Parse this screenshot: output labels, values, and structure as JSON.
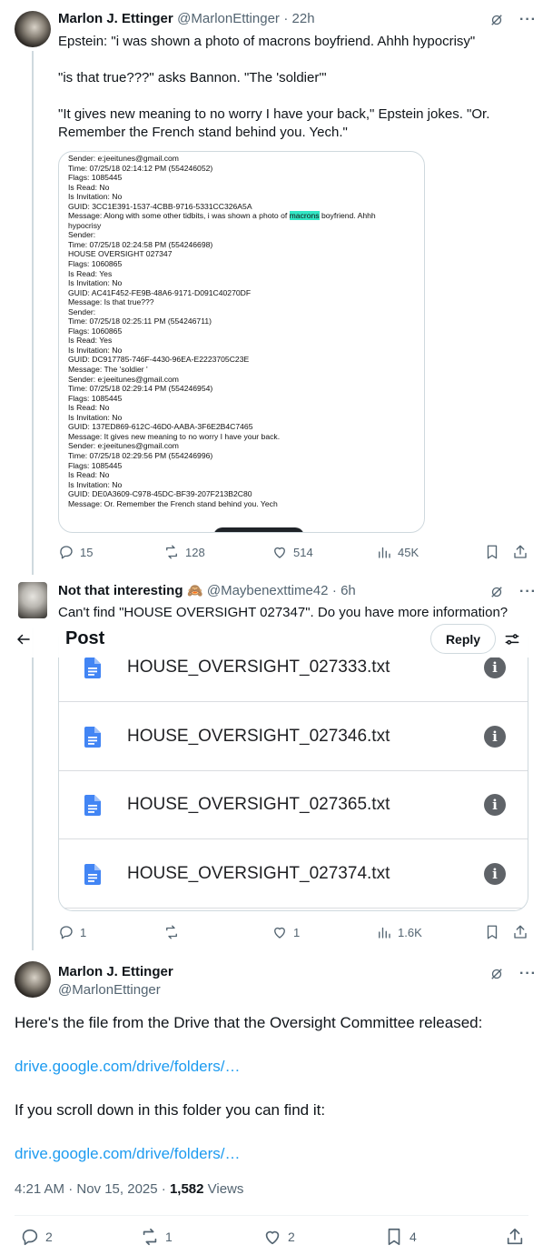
{
  "tweet1": {
    "name": "Marlon J. Ettinger",
    "handle": "@MarlonEttinger",
    "time": "· 22h",
    "text": "Epstein: \"i was shown a photo of macrons boyfriend. Ahhh hypocrisy\"\n\n\"is that true???\" asks Bannon. \"The 'soldier'\"\n\n\"It gives new meaning to no worry I have your back,\" Epstein jokes. \"Or. Remember the French stand behind you. Yech.\"",
    "log_lines": [
      "Sender: e:jeeitunes@gmail.com",
      "Time: 07/25/18 02:14:12 PM (554246052)",
      "Flags: 1085445",
      "Is Read: No",
      "Is Invitation: No",
      "GUID: 3CC1E391-1537-4CBB-9716-5331CC326A5A",
      "Message: Along with some other tidbits, i was shown a photo of |macrons| boyfriend. Ahhh",
      "hypocrisy",
      "Sender:",
      "Time: 07/25/18 02:24:58 PM (554246698)",
      "HOUSE OVERSIGHT 027347",
      "Flags: 1060865",
      "Is Read: Yes",
      "Is Invitation: No",
      "GUID: AC41F452-FE9B-48A6-9171-D091C40270DF",
      "Message: Is that true???",
      "Sender:",
      "Time: 07/25/18 02:25:11 PM (554246711)",
      "Flags: 1060865",
      "Is Read: Yes",
      "Is Invitation: No",
      "GUID: DC917785-746F-4430-96EA-E2223705C23E",
      "Message: The 'soldier '",
      "Sender: e:jeeitunes@gmail.com",
      "Time: 07/25/18 02:29:14 PM (554246954)",
      "Flags: 1085445",
      "Is Read: No",
      "Is Invitation: No",
      "GUID: 137ED869-612C-46D0-AABA-3F6E2B4C7465",
      "Message: It gives new meaning to no worry I have your back.",
      "Sender: e:jeeitunes@gmail.com",
      "Time: 07/25/18 02:29:56 PM (554246996)",
      "Flags: 1085445",
      "Is Read: No",
      "Is Invitation: No",
      "GUID: DE0A3609-C978-45DC-BF39-207F213B2C80",
      "Message: Or. Remember the French stand behind you. Yech"
    ],
    "highlight_word": "macrons",
    "replies": "15",
    "reposts": "128",
    "likes": "514",
    "views": "45K"
  },
  "tweet2": {
    "name": "Not that interesting",
    "emoji": "🙈",
    "handle": "@Maybenexttime42",
    "time": "· 6h",
    "text": "Can't find \"HOUSE OVERSIGHT 027347\". Do you have more information?",
    "drive_files": [
      "HOUSE_OVERSIGHT_027333.txt",
      "HOUSE_OVERSIGHT_027346.txt",
      "HOUSE_OVERSIGHT_027365.txt",
      "HOUSE_OVERSIGHT_027374.txt"
    ],
    "replies": "1",
    "reposts": "",
    "likes": "1",
    "views": "1.6K"
  },
  "header": {
    "title": "Post",
    "reply_label": "Reply"
  },
  "tweet3": {
    "name": "Marlon J. Ettinger",
    "handle": "@MarlonEttinger",
    "text1": "Here's the file from the Drive that the Oversight Committee released:",
    "link1": "drive.google.com/drive/folders/…",
    "text2": "If you scroll down in this folder you can find it:",
    "link2": "drive.google.com/drive/folders/…",
    "timestamp": "4:21 AM · Nov 15, 2025 · ",
    "views_count": "1,582",
    "views_label": " Views",
    "replies": "2",
    "reposts": "1",
    "likes": "2",
    "bookmarks": "4"
  },
  "icons": {
    "reply": "reply-icon",
    "repost": "repost-icon",
    "like": "heart-icon",
    "views": "views-icon",
    "bookmark": "bookmark-icon",
    "share": "share-icon",
    "grok": "grok-icon",
    "more": "more-icon",
    "back": "back-arrow-icon",
    "filter": "filter-icon",
    "doc": "doc-icon",
    "info": "info-icon"
  },
  "colors": {
    "link": "#1d9bf0",
    "text": "#0f1419",
    "secondary": "#536471",
    "highlight": "#33e6c4",
    "drive_doc": "#4285f4"
  }
}
